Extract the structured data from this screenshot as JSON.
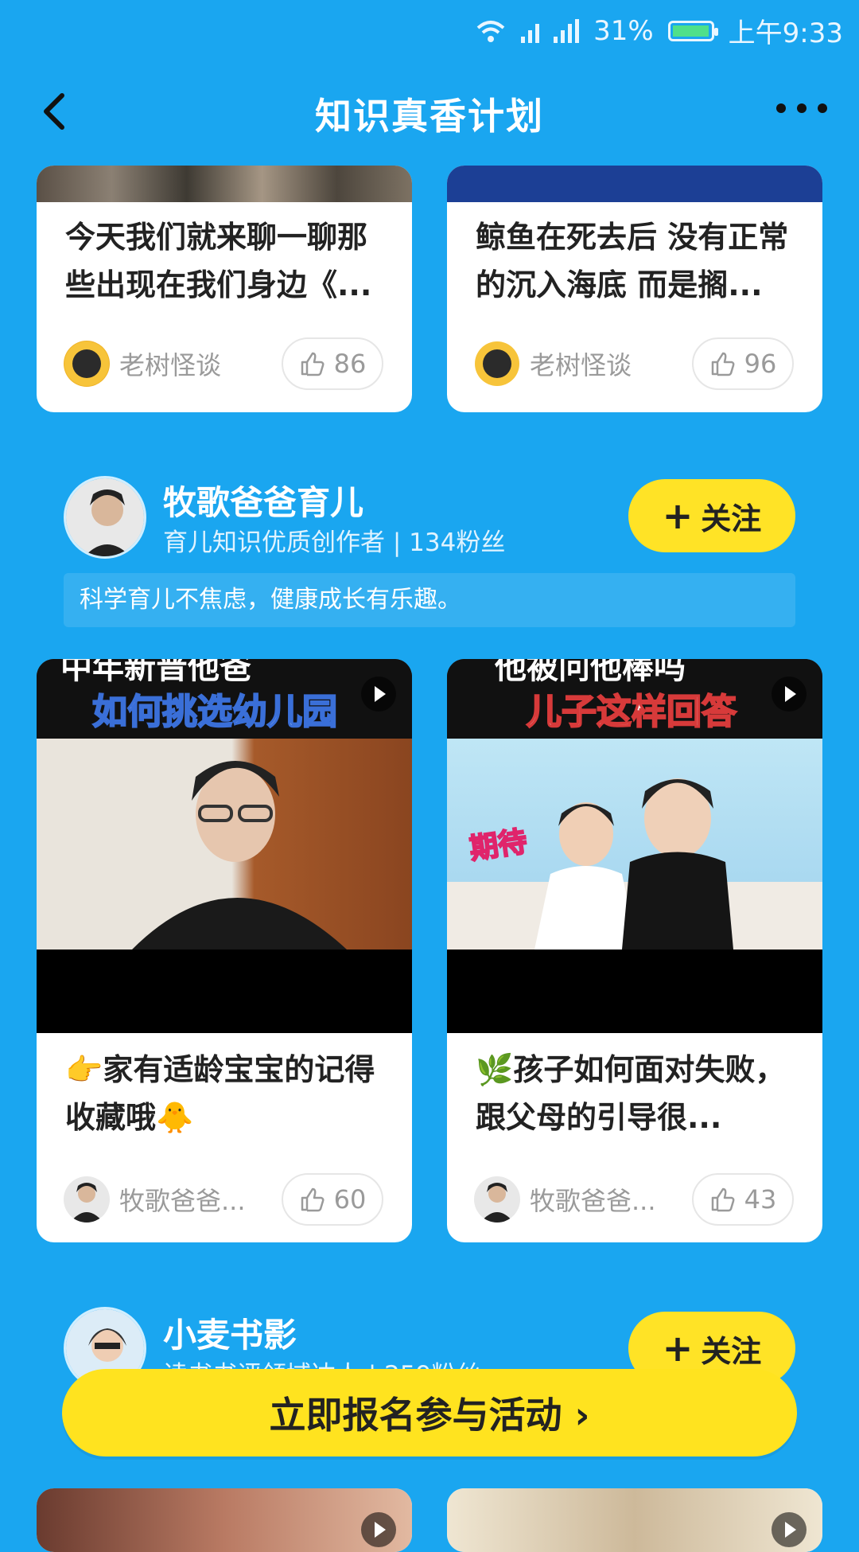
{
  "status_bar": {
    "battery_percent": "31%",
    "time": "上午9:33",
    "battery_level": 0.31
  },
  "header": {
    "title": "知识真香计划"
  },
  "top_cards": [
    {
      "caption": "今天我们就来聊一聊那些出现在我们身边《...",
      "author": "老树怪谈",
      "likes": "86"
    },
    {
      "caption": "鲸鱼在死去后 没有正常的沉入海底 而是搁...",
      "author": "老树怪谈",
      "likes": "96"
    }
  ],
  "creator1": {
    "name": "牧歌爸爸育儿",
    "desc": "育儿知识优质创作者 | 134粉丝",
    "follow_label": "关注",
    "slogan": "科学育儿不焦虑，健康成长有乐趣。",
    "cards": [
      {
        "overlay_line1": "中年新晋他爸",
        "overlay_line2": "如何挑选幼儿园",
        "caption": "👉家有适龄宝宝的记得收藏哦🐥",
        "author": "牧歌爸爸...",
        "likes": "60"
      },
      {
        "overlay_line1": "他被问他棒吗",
        "overlay_line2": "儿子这样回答",
        "badge": "期待",
        "caption": "🌿孩子如何面对失败，跟父母的引导很...",
        "author": "牧歌爸爸...",
        "likes": "43"
      }
    ]
  },
  "creator2": {
    "name": "小麦书影",
    "desc": "读书书评领域达人 | 259粉丝",
    "follow_label": "关注"
  },
  "cta": {
    "label": "立即报名参与活动 ›"
  }
}
